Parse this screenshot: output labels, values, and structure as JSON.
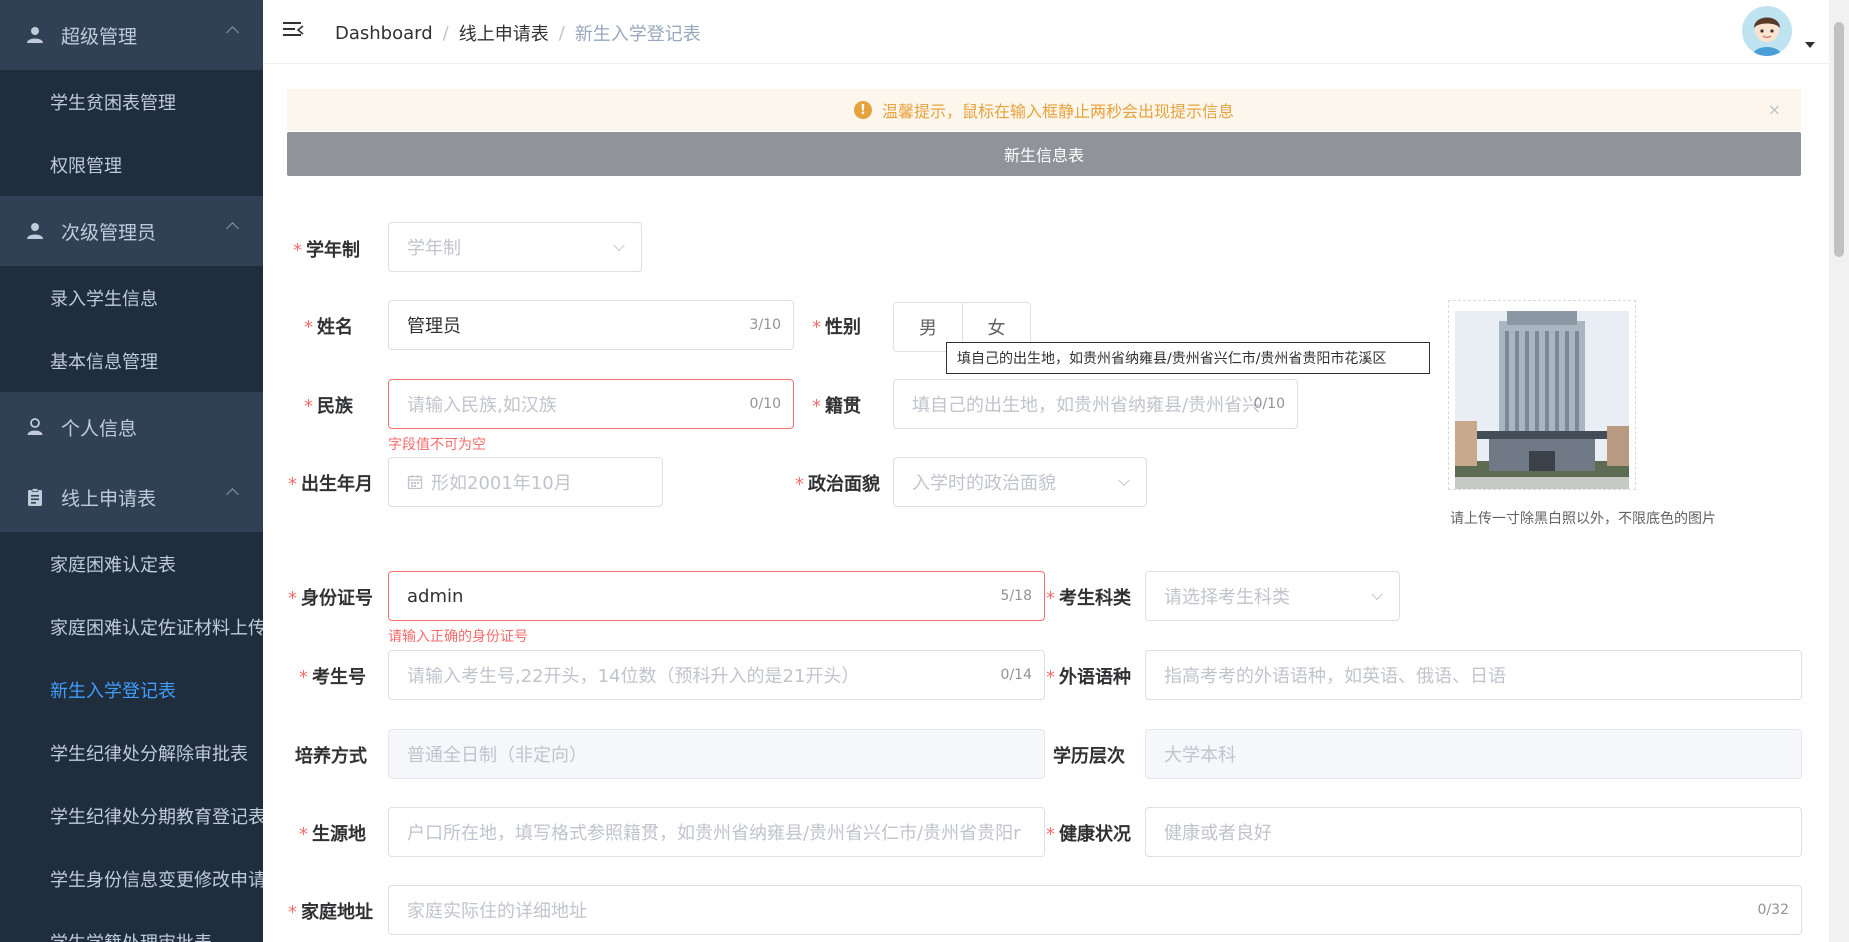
{
  "sidebar": {
    "groups": [
      {
        "label": "超级管理",
        "icon": "user-icon",
        "items": [
          "学生贫困表管理",
          "权限管理"
        ]
      },
      {
        "label": "次级管理员",
        "icon": "user-icon",
        "items": [
          "录入学生信息",
          "基本信息管理"
        ]
      },
      {
        "label": "个人信息",
        "icon": "person-icon",
        "items": []
      },
      {
        "label": "线上申请表",
        "icon": "clipboard-icon",
        "items": [
          "家庭困难认定表",
          "家庭困难认定佐证材料上传",
          "新生入学登记表",
          "学生纪律处分解除审批表",
          "学生纪律处分期教育登记表",
          "学生身份信息变更修改申请表",
          "学生学籍处理审批表"
        ]
      }
    ],
    "active_item": "新生入学登记表"
  },
  "topbar": {
    "breadcrumb": [
      "Dashboard",
      "线上申请表",
      "新生入学登记表"
    ],
    "separator": "/"
  },
  "alert": {
    "text": "温馨提示，鼠标在输入框静止两秒会出现提示信息",
    "close": "×",
    "icon": "!"
  },
  "form": {
    "title": "新生信息表",
    "required_mark": "*",
    "school_system": {
      "label": "学年制",
      "placeholder": "学年制"
    },
    "name": {
      "label": "姓名",
      "value": "管理员",
      "count": "3/10"
    },
    "gender": {
      "label": "性别",
      "options": [
        "男",
        "女"
      ]
    },
    "ethnicity": {
      "label": "民族",
      "placeholder": "请输入民族,如汉族",
      "count": "0/10",
      "error": "字段值不可为空"
    },
    "native_place": {
      "label": "籍贯",
      "placeholder": "填自己的出生地，如贵州省纳雍县/贵州省兴",
      "count": "0/10"
    },
    "tooltip": "填自己的出生地，如贵州省纳雍县/贵州省兴仁市/贵州省贵阳市花溪区",
    "birth": {
      "label": "出生年月",
      "placeholder": "形如2001年10月"
    },
    "political": {
      "label": "政治面貌",
      "placeholder": "入学时的政治面貌"
    },
    "photo_hint": "请上传一寸除黑白照以外，不限底色的图片",
    "id_card": {
      "label": "身份证号",
      "value": "admin",
      "count": "5/18",
      "error": "请输入正确的身份证号"
    },
    "exam_category": {
      "label": "考生科类",
      "placeholder": "请选择考生科类"
    },
    "exam_no": {
      "label": "考生号",
      "placeholder": "请输入考生号,22开头，14位数（预科升入的是21开头）",
      "count": "0/14"
    },
    "foreign_lang": {
      "label": "外语语种",
      "placeholder": "指高考考的外语语种，如英语、俄语、日语"
    },
    "training_mode": {
      "label": "培养方式",
      "placeholder": "普通全日制（非定向）"
    },
    "education_level": {
      "label": "学历层次",
      "placeholder": "大学本科"
    },
    "origin": {
      "label": "生源地",
      "placeholder": "户口所在地，填写格式参照籍贯，如贵州省纳雍县/贵州省兴仁市/贵州省贵阳r"
    },
    "health": {
      "label": "健康状况",
      "placeholder": "健康或者良好"
    },
    "address": {
      "label": "家庭地址",
      "placeholder": "家庭实际住的详细地址",
      "count": "0/32"
    }
  },
  "colors": {
    "sidebar_bg": "#1f2d3d",
    "sidebar_header_bg": "#304156",
    "active": "#409eff",
    "error": "#f56c6c",
    "warning": "#e6a23c"
  }
}
